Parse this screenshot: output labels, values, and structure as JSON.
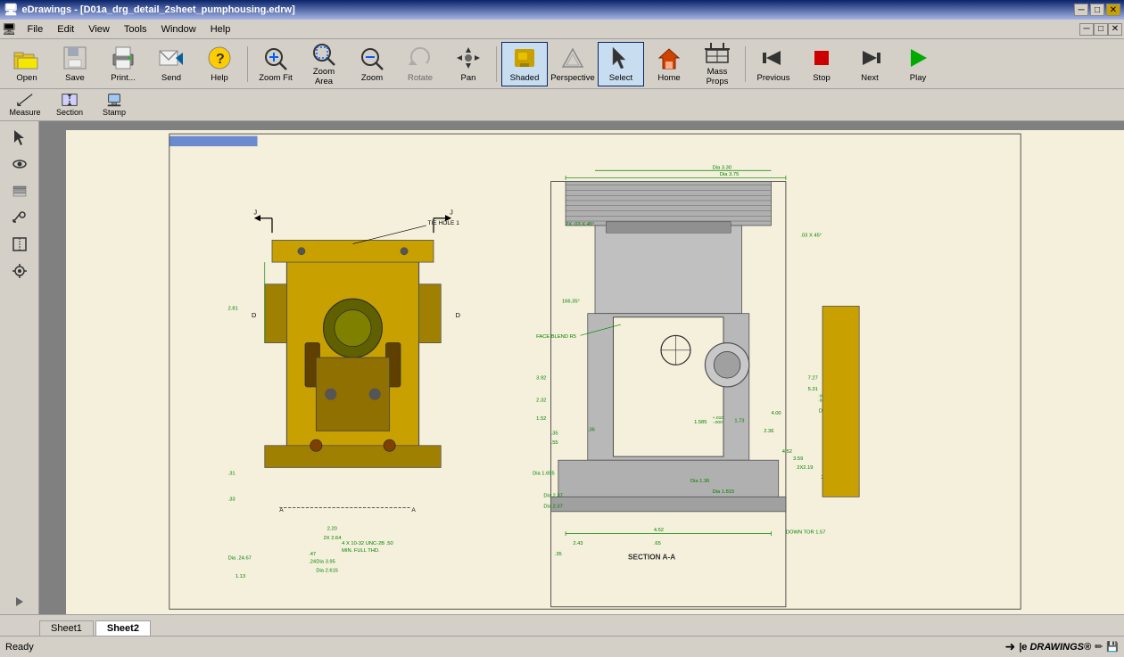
{
  "titlebar": {
    "title": "eDrawings - [D01a_drg_detail_2sheet_pumphousing.edrw]",
    "min_label": "─",
    "max_label": "□",
    "close_label": "✕",
    "inner_min": "─",
    "inner_max": "□",
    "inner_close": "✕"
  },
  "menubar": {
    "items": [
      "File",
      "Edit",
      "View",
      "Tools",
      "Window",
      "Help"
    ]
  },
  "toolbar": {
    "buttons": [
      {
        "id": "open",
        "label": "Open",
        "active": false
      },
      {
        "id": "save",
        "label": "Save",
        "active": false
      },
      {
        "id": "print",
        "label": "Print...",
        "active": false
      },
      {
        "id": "send",
        "label": "Send",
        "active": false
      },
      {
        "id": "help",
        "label": "Help",
        "active": false
      },
      {
        "id": "zoom-fit",
        "label": "Zoom Fit",
        "active": false
      },
      {
        "id": "zoom-area",
        "label": "Zoom Area",
        "active": false
      },
      {
        "id": "zoom",
        "label": "Zoom",
        "active": false
      },
      {
        "id": "rotate",
        "label": "Rotate",
        "active": false
      },
      {
        "id": "pan",
        "label": "Pan",
        "active": false
      },
      {
        "id": "shaded",
        "label": "Shaded",
        "active": true
      },
      {
        "id": "perspective",
        "label": "Perspective",
        "active": false
      },
      {
        "id": "select",
        "label": "Select",
        "active": true
      },
      {
        "id": "home",
        "label": "Home",
        "active": false
      },
      {
        "id": "mass-props",
        "label": "Mass Props",
        "active": false
      },
      {
        "id": "previous",
        "label": "Previous",
        "active": false
      },
      {
        "id": "stop",
        "label": "Stop",
        "active": false
      },
      {
        "id": "next",
        "label": "Next",
        "active": false
      },
      {
        "id": "play",
        "label": "Play",
        "active": false
      }
    ]
  },
  "toolbar2": {
    "buttons": [
      {
        "id": "measure",
        "label": "Measure"
      },
      {
        "id": "section",
        "label": "Section"
      },
      {
        "id": "stamp",
        "label": "Stamp"
      }
    ]
  },
  "sidebar": {
    "buttons": [
      "cursor",
      "eye",
      "layers",
      "markup",
      "section-view",
      "properties"
    ]
  },
  "sheets": {
    "tabs": [
      {
        "id": "sheet1",
        "label": "Sheet1",
        "active": false
      },
      {
        "id": "sheet2",
        "label": "Sheet2",
        "active": true
      }
    ]
  },
  "statusbar": {
    "status_text": "Ready",
    "brand_text": "eDrawings®",
    "icons": [
      "arrow",
      "edit",
      "save"
    ]
  }
}
